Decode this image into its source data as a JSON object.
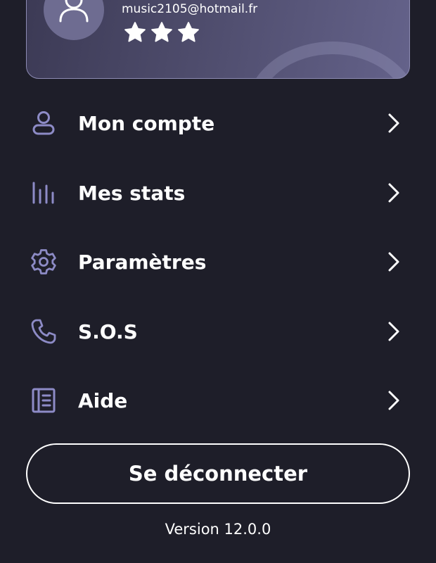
{
  "theme": {
    "background": "#1e1e29",
    "accent": "#8d8bc6",
    "text": "#ffffff"
  },
  "profile": {
    "email": "music2105@hotmail.fr",
    "avatar_icon": "user-icon",
    "rating": 3,
    "rating_max": 3
  },
  "menu": {
    "items": [
      {
        "label": "Mon compte",
        "icon": "user-icon"
      },
      {
        "label": "Mes stats",
        "icon": "bar-chart-icon"
      },
      {
        "label": "Paramètres",
        "icon": "gear-icon"
      },
      {
        "label": "S.O.S",
        "icon": "phone-icon"
      },
      {
        "label": "Aide",
        "icon": "notebook-icon"
      }
    ],
    "chevron_icon": "chevron-right-icon"
  },
  "logout": {
    "label": "Se déconnecter"
  },
  "version": {
    "text": "Version 12.0.0"
  }
}
